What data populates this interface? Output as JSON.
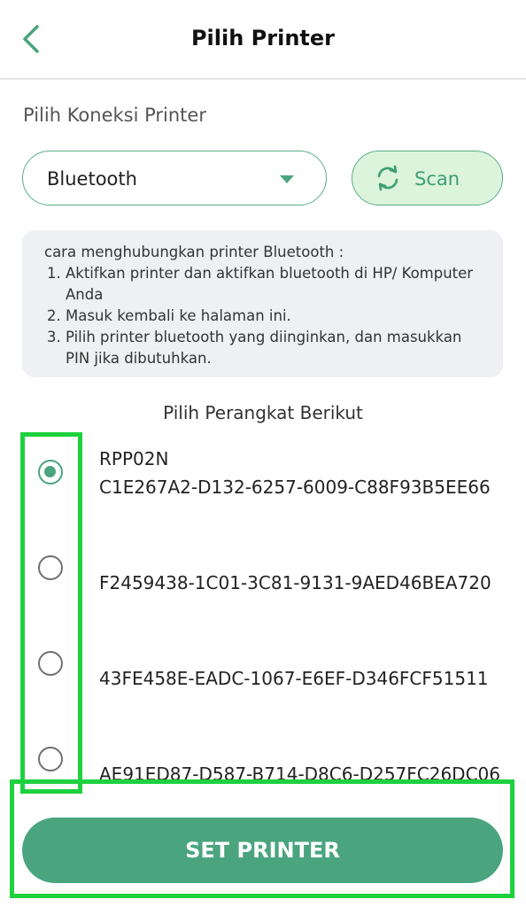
{
  "header": {
    "title": "Pilih Printer",
    "back_icon": "chevron-left-icon"
  },
  "connection": {
    "label": "Pilih Koneksi Printer",
    "selected": "Bluetooth",
    "scan_label": "Scan",
    "scan_icon": "refresh-icon"
  },
  "instructions": {
    "intro": "cara menghubungkan printer Bluetooth :",
    "steps": [
      "Aktifkan printer dan aktifkan bluetooth di HP/ Komputer Anda",
      "Masuk kembali ke halaman ini.",
      "Pilih printer bluetooth yang diinginkan, dan masukkan PIN jika dibutuhkan."
    ]
  },
  "devices": {
    "title": "Pilih Perangkat Berikut",
    "items": [
      {
        "name": "RPP02N",
        "id": "C1E267A2-D132-6257-6009-C88F93B5EE66",
        "selected": true
      },
      {
        "name": "",
        "id": "F2459438-1C01-3C81-9131-9AED46BEA720",
        "selected": false
      },
      {
        "name": "",
        "id": "43FE458E-EADC-1067-E6EF-D346FCF51511",
        "selected": false
      },
      {
        "name": "",
        "id": "AE91ED87-D587-B714-D8C6-D257FC26DC06",
        "selected": false
      }
    ]
  },
  "action": {
    "set_label": "SET PRINTER"
  },
  "colors": {
    "accent": "#4aa57f",
    "highlight": "#1ed13e",
    "scan_bg": "#dcf3dc",
    "info_bg": "#eef0f3"
  }
}
